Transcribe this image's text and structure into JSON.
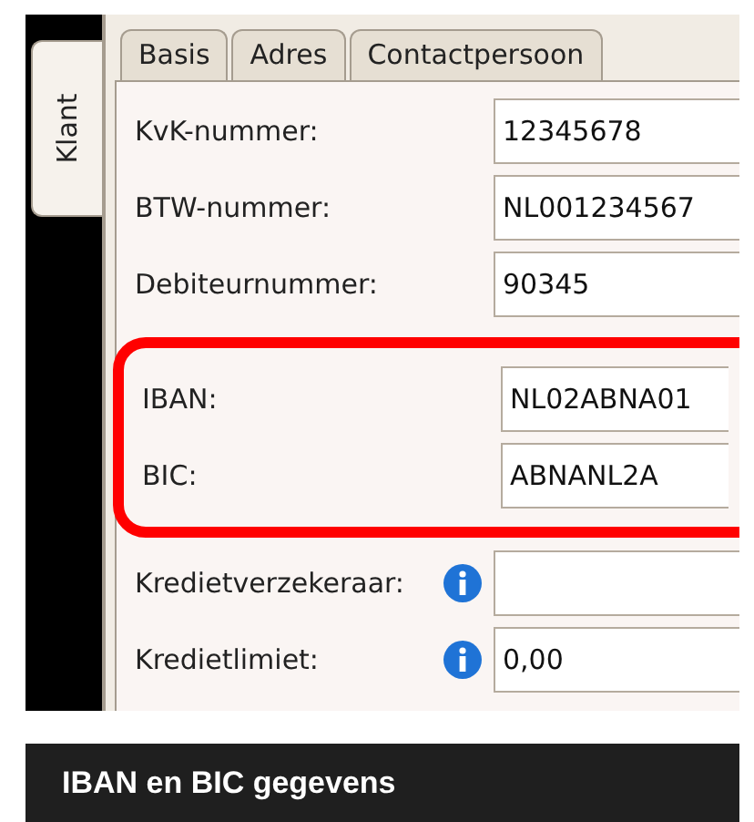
{
  "side_tabs": [
    {
      "label": "Klant",
      "selected": true
    }
  ],
  "tabs": [
    {
      "label": "Basis",
      "selected": false
    },
    {
      "label": "Adres",
      "selected": false
    },
    {
      "label": "Contactpersoon",
      "selected": false
    }
  ],
  "sections": [
    {
      "highlighted": false,
      "fields": [
        {
          "label": "KvK-nummer:",
          "value": "12345678",
          "info": false
        },
        {
          "label": "BTW-nummer:",
          "value": "NL001234567",
          "info": false
        },
        {
          "label": "Debiteurnummer:",
          "value": "90345",
          "info": false
        }
      ]
    },
    {
      "highlighted": true,
      "fields": [
        {
          "label": "IBAN:",
          "value": "NL02ABNA01",
          "info": false
        },
        {
          "label": "BIC:",
          "value": "ABNANL2A",
          "info": false
        }
      ]
    },
    {
      "highlighted": false,
      "fields": [
        {
          "label": "Kredietverzekeraar:",
          "info": true
        },
        {
          "label": "Kredietlimiet:",
          "value": "0,00",
          "info": true
        }
      ]
    }
  ],
  "caption": "IBAN en BIC gegevens"
}
